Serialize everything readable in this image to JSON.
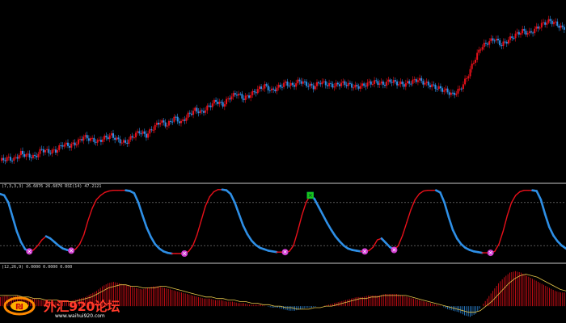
{
  "panel_indicator_1": {
    "label": "(7,3,3,3) 26.6876 26.6876 RSI(14) 47.2121"
  },
  "panel_indicator_2": {
    "label": "(12,26,9) 0.0000 0.0000 0.000"
  },
  "watermark": {
    "brand": "外汇920论坛",
    "url": "www.waihui920.com"
  },
  "colors": {
    "background": "#000000",
    "bull": "#e8101a",
    "bear": "#2e8fe6",
    "separator": "#c8c8c8",
    "level_line": "#8c8c8c",
    "signal_top": "#19c819",
    "signal_bottom": "#d23cd2",
    "macd_signal": "#e8c84a"
  },
  "chart_data": [
    {
      "type": "candlestick",
      "title": "",
      "description_series": "close",
      "close": [
        1.0,
        1.2,
        1.1,
        1.6,
        1.4,
        1.3,
        1.9,
        1.7,
        1.8,
        2.3,
        2.2,
        2.4,
        2.9,
        2.7,
        2.5,
        2.8,
        3.0,
        2.6,
        2.4,
        2.9,
        3.3,
        3.0,
        3.6,
        4.1,
        3.8,
        4.4,
        4.0,
        4.6,
        5.0,
        4.8,
        5.3,
        5.7,
        5.4,
        6.0,
        6.3,
        5.9,
        6.2,
        6.6,
        6.9,
        6.5,
        6.8,
        7.1,
        6.9,
        7.3,
        7.0,
        6.8,
        7.2,
        7.0,
        6.9,
        7.1,
        7.0,
        6.8,
        6.9,
        7.1,
        7.2,
        7.0,
        7.3,
        7.1,
        7.0,
        7.2,
        7.4,
        7.1,
        6.9,
        6.7,
        6.5,
        6.2,
        6.6,
        7.5,
        8.8,
        9.9,
        10.3,
        10.6,
        10.1,
        10.5,
        10.9,
        11.2,
        11.0,
        11.4,
        11.8,
        12.0,
        11.7,
        11.3
      ],
      "up_down_pattern": "mixed",
      "ylim": [
        0,
        13
      ]
    },
    {
      "type": "line",
      "title": "",
      "description": "stochastic oscillator with two level lines and signal markers",
      "ylim": [
        0,
        100
      ],
      "levels": [
        80,
        20
      ],
      "values": [
        92,
        90,
        80,
        60,
        40,
        25,
        15,
        12,
        14,
        20,
        28,
        33,
        30,
        25,
        20,
        16,
        14,
        13,
        15,
        22,
        35,
        55,
        72,
        84,
        90,
        94,
        96,
        97,
        97,
        97,
        97,
        96,
        93,
        80,
        62,
        45,
        32,
        22,
        16,
        12,
        10,
        9,
        9,
        9,
        9,
        12,
        20,
        35,
        55,
        75,
        88,
        95,
        98,
        98,
        97,
        92,
        80,
        64,
        48,
        36,
        27,
        21,
        17,
        15,
        13,
        12,
        11,
        11,
        11,
        12,
        20,
        40,
        62,
        80,
        90,
        85,
        74,
        63,
        52,
        42,
        33,
        26,
        20,
        16,
        14,
        13,
        12,
        12,
        13,
        18,
        28,
        30,
        24,
        18,
        14,
        20,
        34,
        52,
        70,
        84,
        92,
        96,
        97,
        97,
        97,
        94,
        80,
        60,
        42,
        30,
        22,
        17,
        14,
        12,
        11,
        10,
        10,
        10,
        12,
        22,
        40,
        62,
        80,
        90,
        95,
        97,
        97,
        97,
        96,
        84,
        64,
        46,
        34,
        26,
        20,
        16
      ]
    },
    {
      "type": "bar",
      "title": "",
      "description": "MACD histogram with signal line",
      "ylim": [
        -10,
        25
      ],
      "histogram": [
        6,
        7,
        6,
        7,
        6,
        5,
        5,
        4,
        4,
        3,
        3,
        3,
        3,
        4,
        5,
        6,
        8,
        10,
        13,
        15,
        16,
        15,
        14,
        13,
        12,
        11,
        12,
        13,
        13,
        12,
        11,
        10,
        9,
        8,
        7,
        6,
        5,
        5,
        4,
        4,
        3,
        3,
        2,
        2,
        1,
        1,
        1,
        0,
        -1,
        -1,
        -2,
        -3,
        -3,
        -2,
        -1,
        -1,
        0,
        0,
        1,
        2,
        3,
        4,
        5,
        6,
        6,
        7,
        7,
        7,
        8,
        8,
        8,
        7,
        6,
        5,
        4,
        3,
        2,
        1,
        0,
        -2,
        -3,
        -4,
        -6,
        -7,
        -5,
        0,
        5,
        10,
        15,
        19,
        22,
        23,
        22,
        20,
        18,
        16,
        14,
        12,
        10,
        9
      ],
      "signal": [
        7,
        7,
        7,
        7,
        6,
        6,
        5,
        5,
        4,
        4,
        4,
        3,
        3,
        3,
        4,
        5,
        6,
        8,
        10,
        12,
        13,
        14,
        14,
        13,
        13,
        12,
        12,
        12,
        13,
        13,
        12,
        11,
        10,
        9,
        8,
        7,
        6,
        6,
        5,
        5,
        4,
        4,
        3,
        3,
        2,
        2,
        1,
        1,
        0,
        0,
        -1,
        -1,
        -2,
        -2,
        -2,
        -1,
        -1,
        0,
        0,
        1,
        2,
        3,
        4,
        5,
        5,
        6,
        6,
        7,
        7,
        7,
        7,
        7,
        6,
        5,
        4,
        3,
        2,
        1,
        0,
        -1,
        -2,
        -3,
        -4,
        -4,
        -3,
        0,
        3,
        7,
        11,
        15,
        18,
        20,
        21,
        20,
        19,
        17,
        15,
        13,
        11,
        10
      ]
    }
  ]
}
